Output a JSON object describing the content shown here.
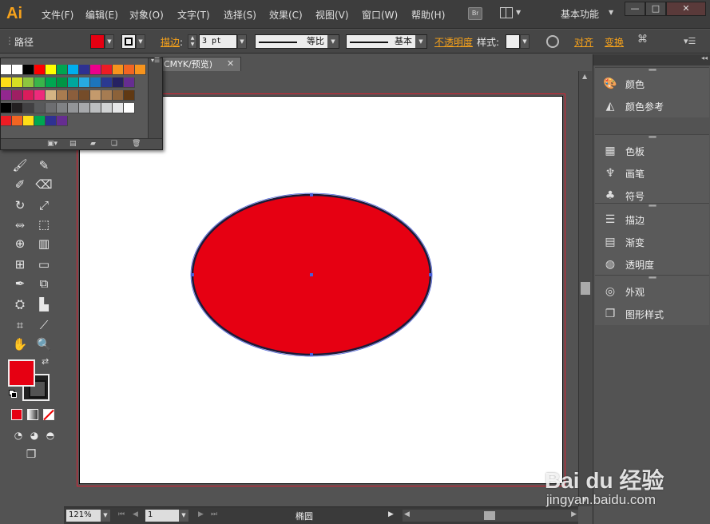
{
  "app": {
    "logo": "Ai",
    "bridge_badge": "Br",
    "workspace": "基本功能"
  },
  "menu": {
    "items": [
      "文件(F)",
      "编辑(E)",
      "对象(O)",
      "文字(T)",
      "选择(S)",
      "效果(C)",
      "视图(V)",
      "窗口(W)",
      "帮助(H)"
    ]
  },
  "window_controls": {
    "minimize": "—",
    "maximize": "□",
    "close": "✕"
  },
  "control_bar": {
    "selection_type": "路径",
    "fill_color": "#e60012",
    "stroke_label": "描边",
    "stroke_weight": "3 pt",
    "stroke_profile": "等比",
    "brush": "基本",
    "opacity_label": "不透明度",
    "style_label": "样式",
    "align_label": "对齐",
    "transform_label": "变换"
  },
  "document": {
    "tab_title": "CMYK/预览)",
    "zoom": "121%",
    "page": "1",
    "status": "椭圆"
  },
  "canvas": {
    "artboard_color": "#ffffff",
    "ellipse_fill": "#e60012",
    "ellipse_stroke": "#1a1a3a"
  },
  "swatches": {
    "rows": [
      [
        "#ffffff",
        "#ffffff",
        "#000000",
        "#ff0000",
        "#ffff00",
        "#00a651",
        "#00aeef",
        "#2e3192",
        "#ec008c",
        "#ed1c24",
        "#f7941d",
        "#f26522",
        "#f7941d"
      ],
      [
        "#ffde17",
        "#d7df23",
        "#8dc63f",
        "#39b54a",
        "#00a651",
        "#009444",
        "#00a79d",
        "#27aae1",
        "#1c75bc",
        "#2b3990",
        "#262262",
        "#662d91"
      ],
      [
        "#92278f",
        "#9e1f63",
        "#da1c5c",
        "#ee2a7b",
        "#d4b483",
        "#a97c50",
        "#8b5e3c",
        "#754c29",
        "#c49a6c",
        "#a67c52",
        "#8c6239",
        "#603913"
      ],
      [
        "#000000",
        "#231f20",
        "#414042",
        "#58595b",
        "#6d6e71",
        "#808285",
        "#939598",
        "#a7a9ac",
        "#bcbec0",
        "#d1d3d4",
        "#e6e7e8",
        "#ffffff"
      ],
      [
        "#ed1c24",
        "#f26522",
        "#ffde17",
        "#00a651",
        "#2e3192",
        "#662d91"
      ]
    ]
  },
  "right_panel": {
    "groups": [
      [
        {
          "icon": "palette-icon",
          "glyph": "🎨",
          "label": "颜色"
        },
        {
          "icon": "color-guide-icon",
          "glyph": "◭",
          "label": "颜色参考"
        }
      ],
      [
        {
          "icon": "swatches-icon",
          "glyph": "▦",
          "label": "色板"
        },
        {
          "icon": "brush-icon",
          "glyph": "♆",
          "label": "画笔"
        },
        {
          "icon": "symbol-icon",
          "glyph": "♣",
          "label": "符号"
        }
      ],
      [
        {
          "icon": "stroke-icon",
          "glyph": "☰",
          "label": "描边"
        },
        {
          "icon": "gradient-icon",
          "glyph": "▤",
          "label": "渐变"
        },
        {
          "icon": "transparency-icon",
          "glyph": "◍",
          "label": "透明度"
        }
      ],
      [
        {
          "icon": "appearance-icon",
          "glyph": "◎",
          "label": "外观"
        },
        {
          "icon": "graphic-styles-icon",
          "glyph": "❐",
          "label": "图形样式"
        }
      ]
    ]
  },
  "watermark": {
    "brand": "Bai du 经验",
    "url": "jingyan.baidu.com"
  }
}
